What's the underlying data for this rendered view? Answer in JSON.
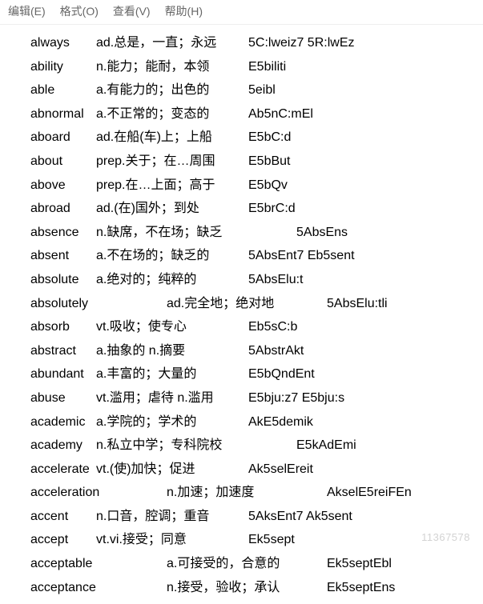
{
  "menubar": {
    "edit": "编辑(E)",
    "format": "格式(O)",
    "view": "查看(V)",
    "help": "帮助(H)"
  },
  "rows": [
    {
      "c1": "always",
      "c2": "ad.总是，一直；永远",
      "c3": "5C:lweiz7 5R:lwEz",
      "w1": 82,
      "w2": 190
    },
    {
      "c1": "ability",
      "c2": "n.能力；能耐，本领",
      "c3": "E5biliti",
      "w1": 82,
      "w2": 190
    },
    {
      "c1": "able",
      "c2": "a.有能力的；出色的",
      "c3": "5eibl",
      "w1": 82,
      "w2": 190
    },
    {
      "c1": "abnormal",
      "c2": "a.不正常的；变态的",
      "c3": "Ab5nC:mEl",
      "w1": 82,
      "w2": 190
    },
    {
      "c1": "aboard",
      "c2": "ad.在船(车)上；上船",
      "c3": "E5bC:d",
      "w1": 82,
      "w2": 190
    },
    {
      "c1": "about",
      "c2": "prep.关于；在…周围",
      "c3": "E5bBut",
      "w1": 82,
      "w2": 190
    },
    {
      "c1": "above",
      "c2": "prep.在…上面；高于",
      "c3": "E5bQv",
      "w1": 82,
      "w2": 190
    },
    {
      "c1": "abroad",
      "c2": "ad.(在)国外；到处",
      "c3": "E5brC:d",
      "w1": 82,
      "w2": 190
    },
    {
      "c1": "absence",
      "c2": "n.缺席，不在场；缺乏",
      "c3": "5AbsEns",
      "w1": 82,
      "w2": 250
    },
    {
      "c1": "absent",
      "c2": "a.不在场的；缺乏的",
      "c3": "5AbsEnt7 Eb5sent",
      "w1": 82,
      "w2": 190
    },
    {
      "c1": "absolute",
      "c2": "a.绝对的；纯粹的",
      "c3": "5AbsElu:t",
      "w1": 82,
      "w2": 190
    },
    {
      "c1": "absolutely",
      "c2": "ad.完全地；绝对地",
      "c3": "5AbsElu:tli",
      "w1": 170,
      "w2": 200
    },
    {
      "c1": "absorb",
      "c2": "vt.吸收；使专心",
      "c3": "Eb5sC:b",
      "w1": 82,
      "w2": 190
    },
    {
      "c1": "abstract",
      "c2": "a.抽象的 n.摘要",
      "c3": "5AbstrAkt",
      "w1": 82,
      "w2": 190
    },
    {
      "c1": "abundant",
      "c2": "a.丰富的；大量的",
      "c3": "E5bQndEnt",
      "w1": 82,
      "w2": 190
    },
    {
      "c1": "abuse",
      "c2": "vt.滥用；虐待 n.滥用",
      "c3": "E5bju:z7 E5bju:s",
      "w1": 82,
      "w2": 190
    },
    {
      "c1": "academic",
      "c2": "a.学院的；学术的",
      "c3": "AkE5demik",
      "w1": 82,
      "w2": 190
    },
    {
      "c1": "academy",
      "c2": "n.私立中学；专科院校",
      "c3": "E5kAdEmi",
      "w1": 82,
      "w2": 250
    },
    {
      "c1": "accelerate",
      "c2": "vt.(使)加快；促进",
      "c3": "Ak5selEreit",
      "w1": 82,
      "w2": 190
    },
    {
      "c1": "acceleration",
      "c2": "n.加速；加速度",
      "c3": "AkselE5reiFEn",
      "w1": 170,
      "w2": 200
    },
    {
      "c1": "accent",
      "c2": "n.口音，腔调；重音",
      "c3": "5AksEnt7 Ak5sent",
      "w1": 82,
      "w2": 190
    },
    {
      "c1": "accept",
      "c2": "vt.vi.接受；同意",
      "c3": "Ek5sept",
      "w1": 82,
      "w2": 190
    },
    {
      "c1": "acceptable",
      "c2": "a.可接受的，合意的",
      "c3": "Ek5septEbl",
      "w1": 170,
      "w2": 200
    },
    {
      "c1": "acceptance",
      "c2": "n.接受，验收；承认",
      "c3": "Ek5septEns",
      "w1": 170,
      "w2": 200
    }
  ],
  "watermark": "11367578"
}
